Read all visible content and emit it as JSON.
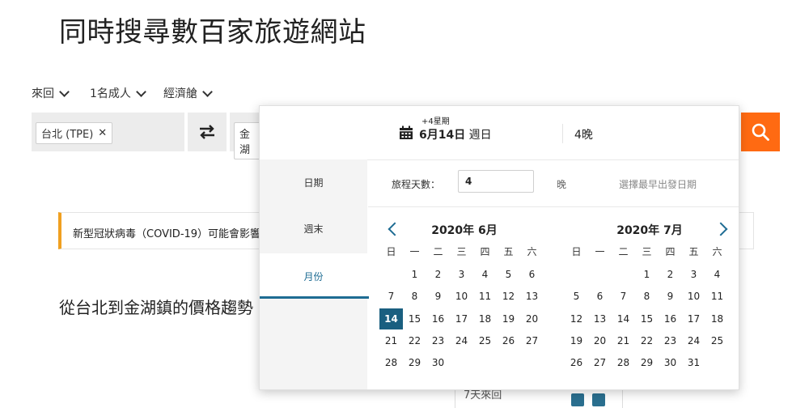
{
  "header": {
    "title": "同時搜尋數百家旅遊網站"
  },
  "options": {
    "trip_type": "來回",
    "travelers": "1名成人",
    "cabin": "經濟艙"
  },
  "search": {
    "origin_chip": "台北 (TPE)",
    "destination_partial": "金湖"
  },
  "notice": {
    "text": "新型冠狀病毒（COVID-19）可能會影響"
  },
  "trend": {
    "title": "從台北到金湖鎮的價格趨勢"
  },
  "under": {
    "text": "7天來回"
  },
  "popup": {
    "plus_week": "+4星期",
    "date_bold": "6月14日",
    "date_weekday": " 週日",
    "nights": "4晚",
    "sidebar": [
      "日期",
      "週末",
      "月份"
    ],
    "duration_label": "旅程天數：",
    "duration_value": "4",
    "night_unit": "晚",
    "earliest_hint": "選擇最早出發日期",
    "weekday_headers": [
      "日",
      "一",
      "二",
      "三",
      "四",
      "五",
      "六"
    ],
    "months": [
      {
        "title": "2020年 6月",
        "first_weekday": 1,
        "days": 30,
        "selected": 14
      },
      {
        "title": "2020年 7月",
        "first_weekday": 3,
        "days": 31,
        "selected": null
      }
    ]
  },
  "colors": {
    "accent": "#1a5f80",
    "search_button": "#ff6a12",
    "notice_bar": "#f0a020"
  }
}
